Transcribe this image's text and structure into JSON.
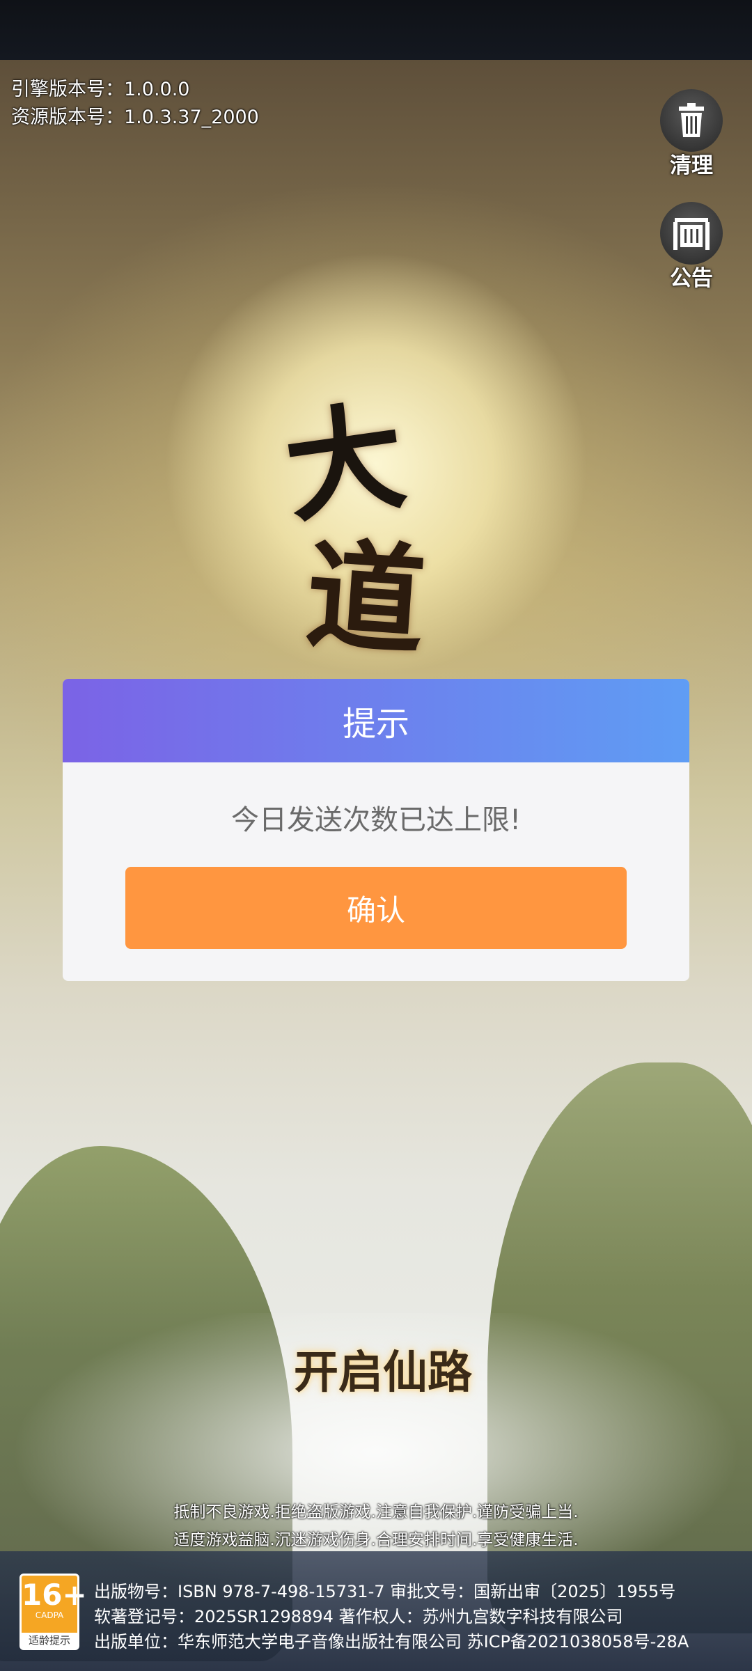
{
  "version": {
    "engine": "引擎版本号：1.0.0.0",
    "resource": "资源版本号：1.0.3.37_2000"
  },
  "side_buttons": {
    "clean": {
      "label": "清理",
      "icon": "trash-icon"
    },
    "notice": {
      "label": "公告",
      "icon": "notice-board-icon"
    }
  },
  "artwork": {
    "title_chars": [
      "大",
      "道"
    ],
    "slogan": "开启仙路"
  },
  "dialog": {
    "title": "提示",
    "message": "今日发送次数已达上限!",
    "confirm_label": "确认"
  },
  "advisory": {
    "line1": "抵制不良游戏.拒绝盗版游戏.注意自我保护.谨防受骗上当.",
    "line2": "适度游戏益脑.沉迷游戏伤身.合理安排时间.享受健康生活."
  },
  "age_rating": {
    "age": "16+",
    "org": "CADPA",
    "tip": "适龄提示"
  },
  "publication": {
    "line1": "出版物号：ISBN 978-7-498-15731-7 审批文号：国新出审〔2025〕1955号",
    "line2": "软著登记号：2025SR1298894 著作权人：苏州九宫数字科技有限公司",
    "line3": "出版单位：华东师范大学电子音像出版社有限公司 苏ICP备2021038058号-28A"
  },
  "colors": {
    "dialog_header_start": "#7b63e6",
    "dialog_header_end": "#5f9df4",
    "confirm_button": "#ff9640",
    "age_badge": "#f5a623"
  }
}
